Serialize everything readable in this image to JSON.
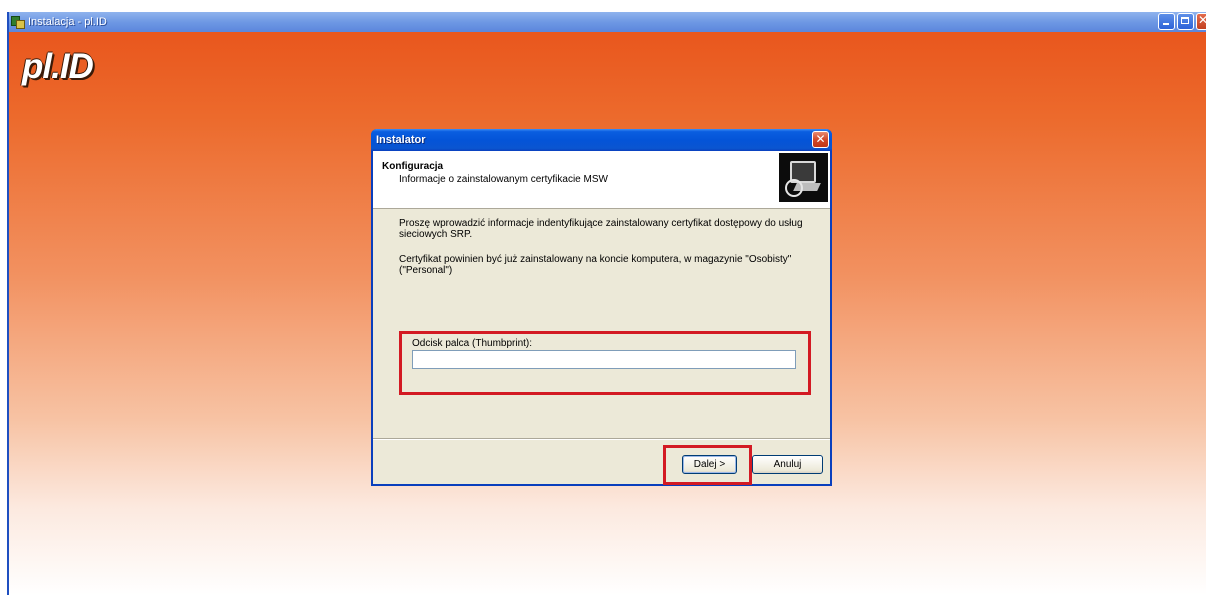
{
  "main_window": {
    "title": "Instalacja - pl.ID",
    "logo_text": "pl.ID",
    "controls": [
      "minimize",
      "maximize",
      "close"
    ]
  },
  "dialog": {
    "title": "Instalator",
    "header": {
      "title": "Konfiguracja",
      "subtitle": "Informacje o zainstalowanym certyfikacie MSW",
      "icon": "computer-setup-icon"
    },
    "body": {
      "paragraph1": "Proszę wprowadzić informacje indentyfikujące zainstalowany certyfikat dostępowy do usług sieciowych SRP.",
      "paragraph2": "Certyfikat powinien być już zainstalowany na koncie komputera, w magazynie \"Osobisty\" (\"Personal\")",
      "thumbprint_label": "Odcisk palca (Thumbprint):",
      "thumbprint_value": ""
    },
    "buttons": {
      "next": "Dalej >",
      "cancel": "Anuluj"
    }
  },
  "colors": {
    "highlight": "#d31a23",
    "title_bar": "#0454d8",
    "background_orange": "#e8521a"
  }
}
